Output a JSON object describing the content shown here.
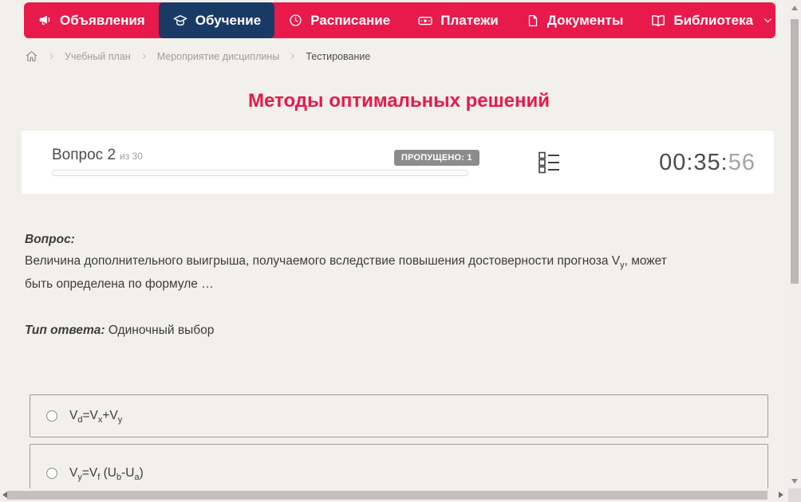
{
  "colors": {
    "accent": "#e8194b",
    "nav-active": "#1a3a66",
    "badge": "#8c8c8c",
    "page-bg": "#f1f0ea"
  },
  "nav": {
    "items": [
      {
        "label": "Объявления",
        "icon": "megaphone-icon"
      },
      {
        "label": "Обучение",
        "icon": "graduation-cap-icon",
        "active": true
      },
      {
        "label": "Расписание",
        "icon": "clock-icon"
      },
      {
        "label": "Платежи",
        "icon": "banknote-icon"
      },
      {
        "label": "Документы",
        "icon": "document-icon"
      },
      {
        "label": "Библиотека",
        "icon": "open-book-icon",
        "dropdown": true
      }
    ]
  },
  "breadcrumb": {
    "home_icon": "home-icon",
    "items": [
      "Учебный план",
      "Мероприятие дисциплины",
      "Тестирование"
    ]
  },
  "page": {
    "title": "Методы оптимальных решений"
  },
  "quiz": {
    "question_label": "Вопрос 2",
    "question_total": "из 30",
    "skipped_badge": "ПРОПУЩЕНО: 1",
    "timer_main": "00:35:",
    "timer_seconds": "56",
    "question_heading": "Вопрос:",
    "question_text_segments": [
      {
        "text": "Величина дополнительного выигрыша, получаемого вследствие повышения достоверности прогноза V"
      },
      {
        "text": "y",
        "sub": true
      },
      {
        "text": ", может"
      },
      {
        "br": true
      },
      {
        "text": "быть определена по формуле …"
      }
    ],
    "answer_type_label": "Тип ответа:",
    "answer_type_value": "Одиночный выбор",
    "options": [
      {
        "formula": [
          {
            "text": "V"
          },
          {
            "text": "d",
            "sub": true
          },
          {
            "text": "=V"
          },
          {
            "text": "x",
            "sub": true
          },
          {
            "text": "+V"
          },
          {
            "text": "y",
            "sub": true
          }
        ]
      },
      {
        "formula": [
          {
            "text": "V"
          },
          {
            "text": "y",
            "sub": true
          },
          {
            "text": "=V"
          },
          {
            "text": "f",
            "sub": true
          },
          {
            "text": " (U"
          },
          {
            "text": "b",
            "sub": true
          },
          {
            "text": "-U"
          },
          {
            "text": "a",
            "sub": true
          },
          {
            "text": ")"
          }
        ]
      }
    ]
  }
}
